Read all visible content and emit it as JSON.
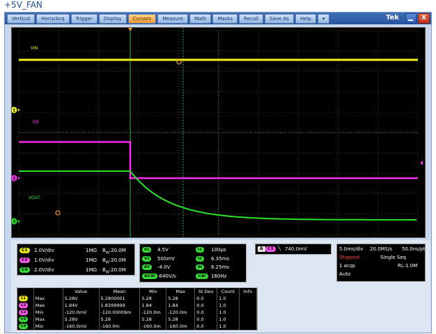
{
  "page_title": "+5V_FAN",
  "menu": [
    "Vertical",
    "Horiz/Acq",
    "Trigger",
    "Display",
    "Cursors",
    "Measure",
    "Math",
    "Masks",
    "Recall",
    "Save As",
    "Help",
    "▾"
  ],
  "active_menu": "Cursors",
  "brand": "Tek",
  "close_glyph": "X",
  "waveforms": {
    "vin_label": "VIN",
    "en_label": "EN",
    "vout_label": "VOUT",
    "colors": {
      "vin": "#f2f20a",
      "en": "#ff2bf0",
      "vout": "#26e626",
      "cursor": "#2db34a",
      "grid": "#3a3a3a"
    }
  },
  "channel_markers": [
    "1",
    "2",
    "3"
  ],
  "channels": [
    {
      "tag": "C1",
      "scale": "2.0V/div",
      "imp": "1MΩ",
      "bw": "B",
      "bw_sub": "W",
      "bw_val": ":20.0M",
      "color": "#e8e800"
    },
    {
      "tag": "C3",
      "scale": "1.0V/div",
      "imp": "1MΩ",
      "bw": "B",
      "bw_sub": "W",
      "bw_val": ":20.0M",
      "color": "#ff55f0"
    },
    {
      "tag": "C4",
      "scale": "2.0V/div",
      "imp": "1MΩ",
      "bw": "B",
      "bw_sub": "W",
      "bw_val": ":20.0M",
      "color": "#33dd33"
    }
  ],
  "cursors": {
    "left": [
      {
        "tag": "V1",
        "value": "4.5V"
      },
      {
        "tag": "V2",
        "value": "500mV"
      },
      {
        "tag": "ΔV",
        "value": "-4.0V"
      },
      {
        "tag": "ΔV/Δt",
        "value": "-640V/s"
      }
    ],
    "right": [
      {
        "tag": "t1",
        "value": "100μs"
      },
      {
        "tag": "t2",
        "value": "6.35ms"
      },
      {
        "tag": "Δt",
        "value": "6.25ms"
      },
      {
        "tag": "1/Δt",
        "value": "160Hz"
      }
    ]
  },
  "trigger": {
    "a": "A",
    "ch": "C3",
    "value": "740.0mV"
  },
  "horizontal": {
    "timediv": "5.0ms/div",
    "rate": "20.0MS/s",
    "res": "50.0ns/pt",
    "status": "Stopped",
    "mode": "Single Seq",
    "acqs": "1 acqs",
    "rl": "RL:1.0M",
    "auto": "Auto"
  },
  "measurements": {
    "headers": [
      "",
      "",
      "Value",
      "Mean",
      "Min",
      "Max",
      "St Dev",
      "Count",
      "Info"
    ],
    "rows": [
      {
        "ch": "C1",
        "color": "#e8e800",
        "name": "Max",
        "value": "5.28V",
        "mean": "5.2800001",
        "min": "5.28",
        "max": "5.28",
        "stdev": "0.0",
        "count": "1.0",
        "info": ""
      },
      {
        "ch": "C3",
        "color": "#ff55f0",
        "name": "Max",
        "value": "1.84V",
        "mean": "1.8399999",
        "min": "1.84",
        "max": "1.84",
        "stdev": "0.0",
        "count": "1.0",
        "info": ""
      },
      {
        "ch": "C3",
        "color": "#ff55f0",
        "name": "Min",
        "value": "-120.0mV",
        "mean": "-120.00009m",
        "min": "-120.0m",
        "max": "-120.0m",
        "stdev": "0.0",
        "count": "1.0",
        "info": ""
      },
      {
        "ch": "C4",
        "color": "#33dd33",
        "name": "Max",
        "value": "5.28V",
        "mean": "5.28",
        "min": "5.28",
        "max": "5.28",
        "stdev": "0.0",
        "count": "1.0",
        "info": ""
      },
      {
        "ch": "C4",
        "color": "#33dd33",
        "name": "Min",
        "value": "-160.0mV",
        "mean": "-160.0m",
        "min": "-160.0m",
        "max": "-160.0m",
        "stdev": "0.0",
        "count": "1.0",
        "info": ""
      }
    ]
  }
}
